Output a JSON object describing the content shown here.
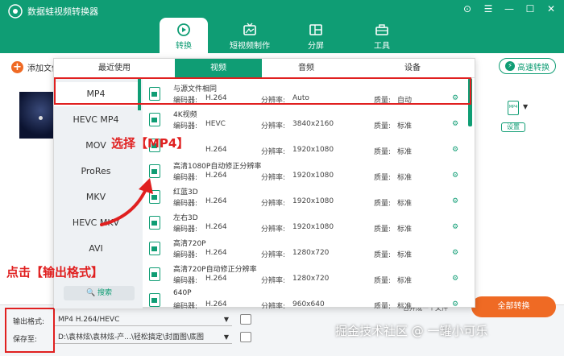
{
  "app": {
    "title": "数据蛙视频转换器"
  },
  "window_controls": [
    "⊙",
    "☰",
    "—",
    "☐",
    "✕"
  ],
  "nav": {
    "tabs": [
      {
        "label": "转换",
        "icon": "convert-icon"
      },
      {
        "label": "短视频制作",
        "icon": "tv-icon"
      },
      {
        "label": "分屏",
        "icon": "split-screen-icon"
      },
      {
        "label": "工具",
        "icon": "toolbox-icon"
      }
    ]
  },
  "toolbar": {
    "add_file": "添加文件",
    "fast_convert": "高速转换"
  },
  "file_item": {
    "format_badge": "MP4",
    "settings": "设置"
  },
  "dialog": {
    "tabs": [
      "最近使用",
      "视频",
      "音频",
      "设备"
    ],
    "formats": [
      "MP4",
      "HEVC MP4",
      "MOV",
      "ProRes",
      "MKV",
      "HEVC MKV",
      "AVI"
    ],
    "search": "🔍 搜索",
    "field_labels": {
      "encoder": "编码器:",
      "resolution": "分辨率:",
      "quality": "质量:"
    },
    "presets": [
      {
        "name": "与源文件相同",
        "encoder": "H.264",
        "resolution": "Auto",
        "quality": "自动"
      },
      {
        "name": "4K视频",
        "encoder": "HEVC",
        "resolution": "3840x2160",
        "quality": "标准"
      },
      {
        "name": "",
        "encoder": "H.264",
        "resolution": "1920x1080",
        "quality": "标准"
      },
      {
        "name": "高清1080P自动修正分辨率",
        "encoder": "H.264",
        "resolution": "1920x1080",
        "quality": "标准"
      },
      {
        "name": "红蓝3D",
        "encoder": "H.264",
        "resolution": "1920x1080",
        "quality": "标准"
      },
      {
        "name": "左右3D",
        "encoder": "H.264",
        "resolution": "1920x1080",
        "quality": "标准"
      },
      {
        "name": "高清720P",
        "encoder": "H.264",
        "resolution": "1280x720",
        "quality": "标准"
      },
      {
        "name": "高清720P自动修正分辨率",
        "encoder": "H.264",
        "resolution": "1280x720",
        "quality": "标准"
      },
      {
        "name": "640P",
        "encoder": "H.264",
        "resolution": "960x640",
        "quality": "标准"
      }
    ]
  },
  "bottom": {
    "output_label": "输出格式:",
    "output_value": "MP4 H.264/HEVC",
    "save_label": "保存至:",
    "save_path": "D:\\袁林炫\\袁林炫-产...\\轻松搞定\\封面图\\底图",
    "merge": "合并成一个文件",
    "start": "全部转换"
  },
  "annotations": {
    "select_mp4": "选择【MP4】",
    "click_output": "点击【输出格式】"
  },
  "watermark": "掘金技术社区 @ 一罐小可乐",
  "colors": {
    "brand": "#0f9d74",
    "accent": "#ef6a24",
    "highlight": "#e02020"
  }
}
